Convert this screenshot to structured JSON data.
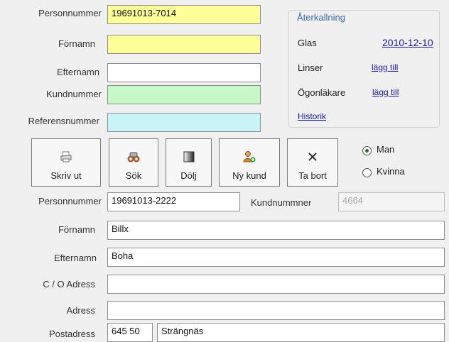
{
  "top_form": {
    "personnummer_label": "Personnummer",
    "personnummer_value": "19691013-7014",
    "fornamn_label": "Förnamn",
    "fornamn_value": "",
    "efternamn_label": "Efternamn",
    "efternamn_value": "",
    "kundnummer_label": "Kundnummer",
    "kundnummer_value": "",
    "referensnummer_label": "Referensnummer",
    "referensnummer_value": ""
  },
  "aterkallning": {
    "title": "Återkallning",
    "glas_label": "Glas",
    "glas_link": "2010-12-10",
    "linser_label": "Linser",
    "linser_link": "lägg till",
    "ogonlakare_label": "Ögonläkare",
    "ogonlakare_link": "lägg till",
    "historik_link": "Historik"
  },
  "toolbar": {
    "print_label": "Skriv ut",
    "search_label": "Sök",
    "hide_label": "Dölj",
    "new_customer_label": "Ny kund",
    "delete_label": "Ta bort"
  },
  "gender": {
    "options": [
      "Man",
      "Kvinna"
    ],
    "selected": "Man"
  },
  "customer_form": {
    "personnummer_label": "Personnummer",
    "personnummer_value": "19691013-2222",
    "kundnummer_label": "Kundnummner",
    "kundnummer_value": "4664",
    "fornamn_label": "Förnamn",
    "fornamn_value": "Billx",
    "efternamn_label": "Efternamn",
    "efternamn_value": "Boha",
    "co_adress_label": "C / O Adress",
    "co_adress_value": "",
    "adress_label": "Adress",
    "adress_value": "",
    "postadress_label": "Postadress",
    "postnummer_value": "645 50",
    "ort_value": "Strängnäs"
  },
  "colors": {
    "yellow_field": "#ffff99",
    "green_field": "#c6f7c6",
    "cyan_field": "#c8f4f8",
    "link": "#1a1aa8",
    "group_title": "#3a67b8"
  }
}
